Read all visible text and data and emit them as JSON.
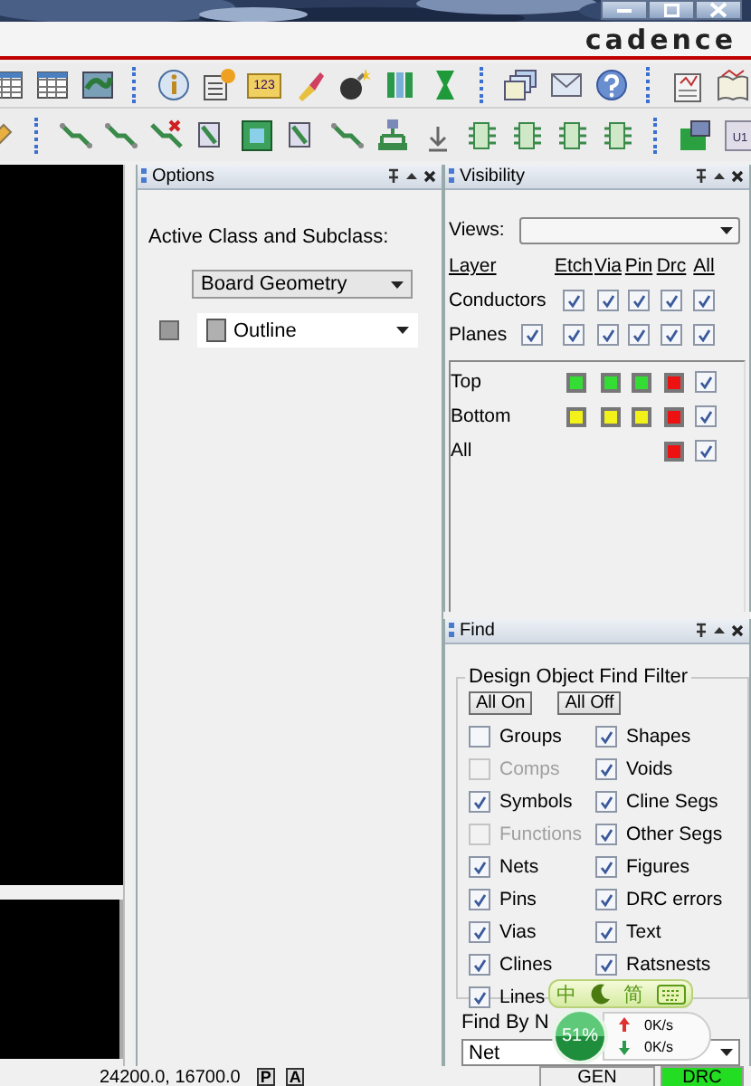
{
  "logo": "cadence",
  "toolbars": {
    "ruler_label": "123",
    "part_label": "U1"
  },
  "options": {
    "title": "Options",
    "label": "Active Class and Subclass:",
    "class_value": "Board Geometry",
    "subclass_value": "Outline"
  },
  "visibility": {
    "title": "Visibility",
    "views_label": "Views:",
    "layer_header": "Layer",
    "columns": [
      "Etch",
      "Via",
      "Pin",
      "Drc",
      "All"
    ],
    "groups": [
      {
        "name": "Conductors",
        "cells": [
          {
            "kind": "empty"
          },
          {
            "kind": "check",
            "checked": true
          },
          {
            "kind": "check",
            "checked": true
          },
          {
            "kind": "check",
            "checked": true
          },
          {
            "kind": "check",
            "checked": true
          },
          {
            "kind": "check",
            "checked": true
          }
        ]
      },
      {
        "name": "Planes",
        "cells": [
          {
            "kind": "check",
            "checked": true
          },
          {
            "kind": "check",
            "checked": true
          },
          {
            "kind": "check",
            "checked": true
          },
          {
            "kind": "check",
            "checked": true
          },
          {
            "kind": "check",
            "checked": true
          },
          {
            "kind": "check",
            "checked": true
          }
        ]
      }
    ],
    "layers": [
      {
        "name": "Top",
        "cells": [
          {
            "kind": "empty"
          },
          {
            "kind": "swatch",
            "color": "#33dd33"
          },
          {
            "kind": "swatch",
            "color": "#33dd33"
          },
          {
            "kind": "swatch",
            "color": "#33dd33"
          },
          {
            "kind": "swatch",
            "color": "#ee1111"
          },
          {
            "kind": "check",
            "checked": true
          }
        ]
      },
      {
        "name": "Bottom",
        "cells": [
          {
            "kind": "empty"
          },
          {
            "kind": "swatch",
            "color": "#f2f21a"
          },
          {
            "kind": "swatch",
            "color": "#f2f21a"
          },
          {
            "kind": "swatch",
            "color": "#f2f21a"
          },
          {
            "kind": "swatch",
            "color": "#ee1111"
          },
          {
            "kind": "check",
            "checked": true
          }
        ]
      },
      {
        "name": "All",
        "cells": [
          {
            "kind": "empty"
          },
          {
            "kind": "empty"
          },
          {
            "kind": "empty"
          },
          {
            "kind": "empty"
          },
          {
            "kind": "swatch",
            "color": "#ee1111"
          },
          {
            "kind": "check",
            "checked": true
          }
        ]
      }
    ]
  },
  "find": {
    "title": "Find",
    "group_title": "Design Object Find Filter",
    "buttons": [
      "All On",
      "All Off"
    ],
    "columns": [
      [
        {
          "label": "Groups",
          "checked": false,
          "disabled": false
        },
        {
          "label": "Comps",
          "checked": false,
          "disabled": true
        },
        {
          "label": "Symbols",
          "checked": true,
          "disabled": false
        },
        {
          "label": "Functions",
          "checked": false,
          "disabled": true
        },
        {
          "label": "Nets",
          "checked": true,
          "disabled": false
        },
        {
          "label": "Pins",
          "checked": true,
          "disabled": false
        },
        {
          "label": "Vias",
          "checked": true,
          "disabled": false
        },
        {
          "label": "Clines",
          "checked": true,
          "disabled": false
        },
        {
          "label": "Lines",
          "checked": true,
          "disabled": false
        }
      ],
      [
        {
          "label": "Shapes",
          "checked": true,
          "disabled": false
        },
        {
          "label": "Voids",
          "checked": true,
          "disabled": false
        },
        {
          "label": "Cline Segs",
          "checked": true,
          "disabled": false
        },
        {
          "label": "Other Segs",
          "checked": true,
          "disabled": false
        },
        {
          "label": "Figures",
          "checked": true,
          "disabled": false
        },
        {
          "label": "DRC errors",
          "checked": true,
          "disabled": false
        },
        {
          "label": "Text",
          "checked": true,
          "disabled": false
        },
        {
          "label": "Ratsnests",
          "checked": true,
          "disabled": false
        }
      ]
    ],
    "find_by_label": "Find By N",
    "find_by_value": "Net"
  },
  "status_bar": {
    "coordinates": "24200.0, 16700.0",
    "mode_buttons": [
      "P",
      "A"
    ],
    "indicators": [
      {
        "label": "GEN",
        "on": false
      },
      {
        "label": "DRC",
        "on": true
      }
    ]
  },
  "ime_bar": {
    "mode": "中",
    "script": "简"
  },
  "network_widget": {
    "usage": "51%",
    "upload": "0K/s",
    "download": "0K/s"
  }
}
